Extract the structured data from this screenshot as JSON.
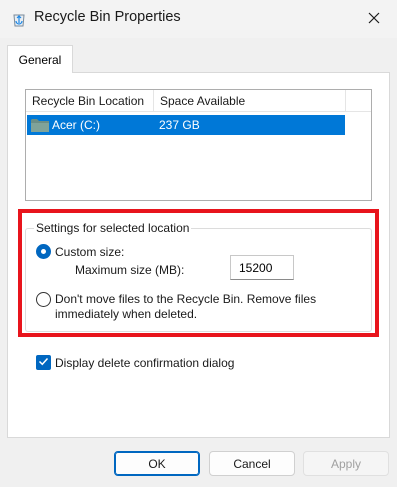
{
  "window": {
    "title": "Recycle Bin Properties",
    "icon": "recycle-bin-icon"
  },
  "tabs": [
    {
      "label": "General",
      "selected": true
    }
  ],
  "list": {
    "columns": [
      "Recycle Bin Location",
      "Space Available"
    ],
    "rows": [
      {
        "location": "Acer (C:)",
        "space": "237 GB",
        "selected": true,
        "icon": "folder-icon"
      }
    ]
  },
  "settings": {
    "group_label": "Settings for selected location",
    "custom_size_label": "Custom size:",
    "custom_size_checked": true,
    "max_size_label": "Maximum size (MB):",
    "max_size_value": "15200",
    "dont_move_label": "Don't move files to the Recycle Bin. Remove files immediately when deleted.",
    "dont_move_checked": false
  },
  "confirm_dialog": {
    "label": "Display delete confirmation dialog",
    "checked": true
  },
  "buttons": {
    "ok": "OK",
    "cancel": "Cancel",
    "apply": "Apply"
  },
  "colors": {
    "accent": "#0067c0",
    "selection": "#0078d7",
    "highlight_box": "#e8141c"
  }
}
